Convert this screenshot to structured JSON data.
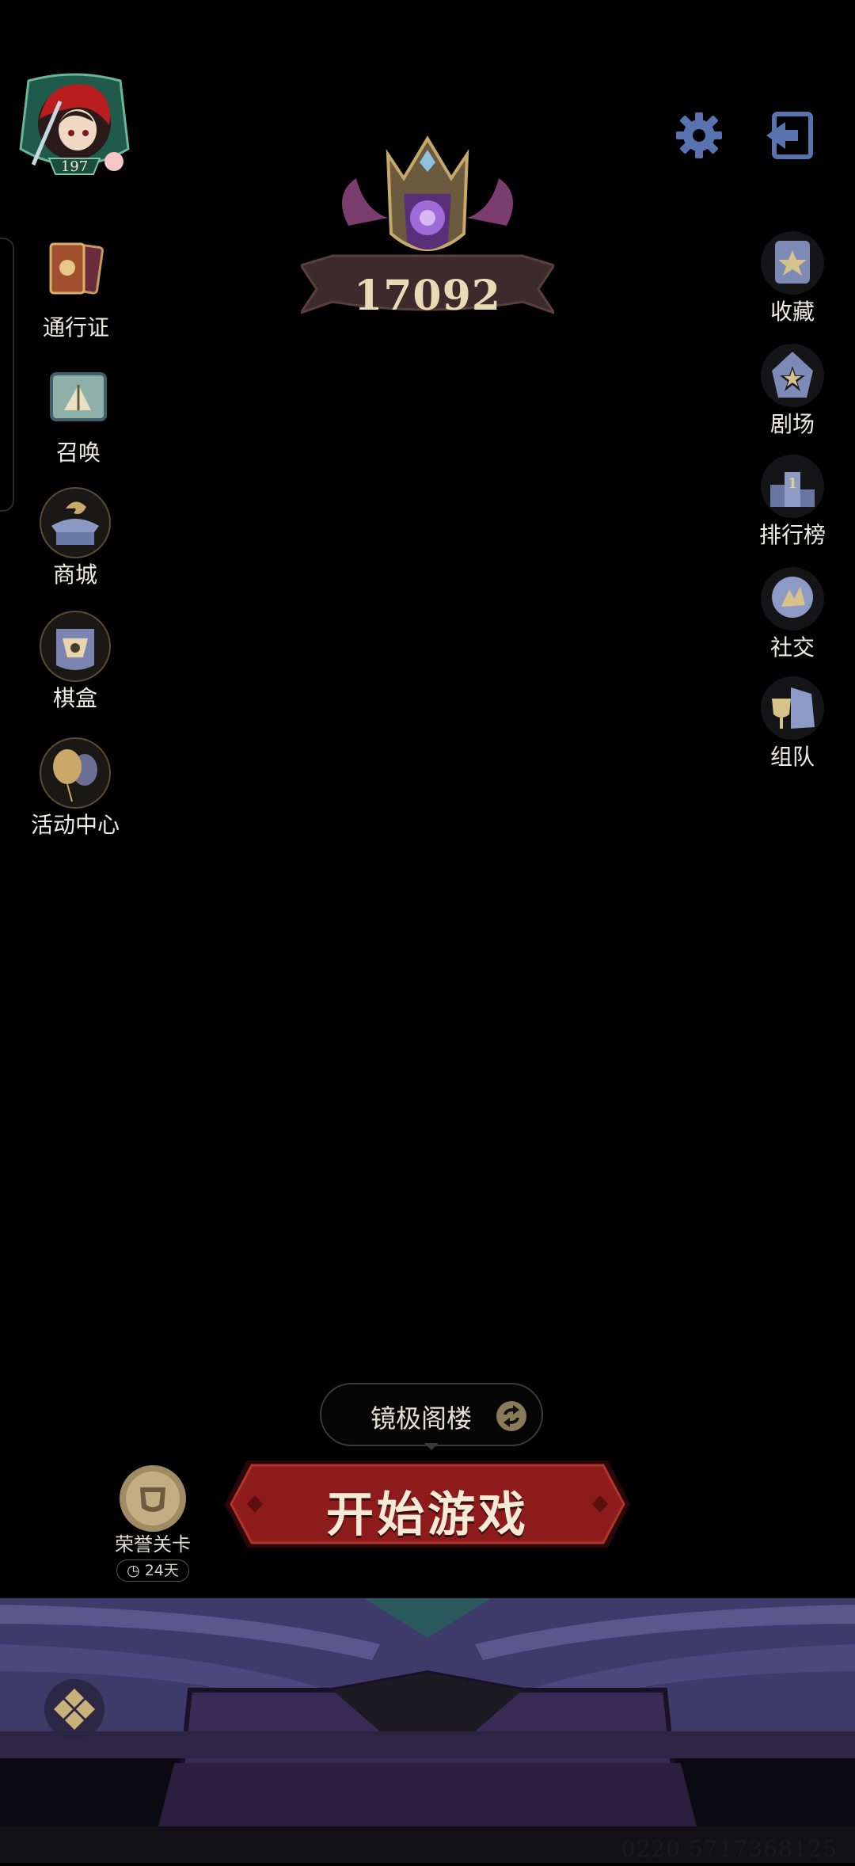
{
  "player": {
    "level": "197"
  },
  "rank": {
    "points": "17092"
  },
  "left_menu": [
    {
      "label": "通行证",
      "icon": "pass-cards-icon"
    },
    {
      "label": "召唤",
      "icon": "summon-scroll-icon"
    },
    {
      "label": "商城",
      "icon": "shop-icon"
    },
    {
      "label": "棋盒",
      "icon": "chess-box-icon"
    },
    {
      "label": "活动中心",
      "icon": "balloon-icon"
    }
  ],
  "right_menu": [
    {
      "label": "收藏",
      "icon": "star-card-icon"
    },
    {
      "label": "剧场",
      "icon": "theater-icon"
    },
    {
      "label": "排行榜",
      "icon": "leaderboard-icon"
    },
    {
      "label": "社交",
      "icon": "social-icon"
    },
    {
      "label": "组队",
      "icon": "team-icon"
    }
  ],
  "mode": {
    "current": "镜极阁楼"
  },
  "start": {
    "label": "开始游戏"
  },
  "honor": {
    "label": "荣誉关卡",
    "timer": "24天"
  },
  "footer": {
    "id": "0220 5717368125"
  },
  "colors": {
    "start_red": "#8e1b1b",
    "gold": "#c9a86a",
    "book_purple": "#4a4577",
    "icon_blue": "#5f6fa0"
  }
}
